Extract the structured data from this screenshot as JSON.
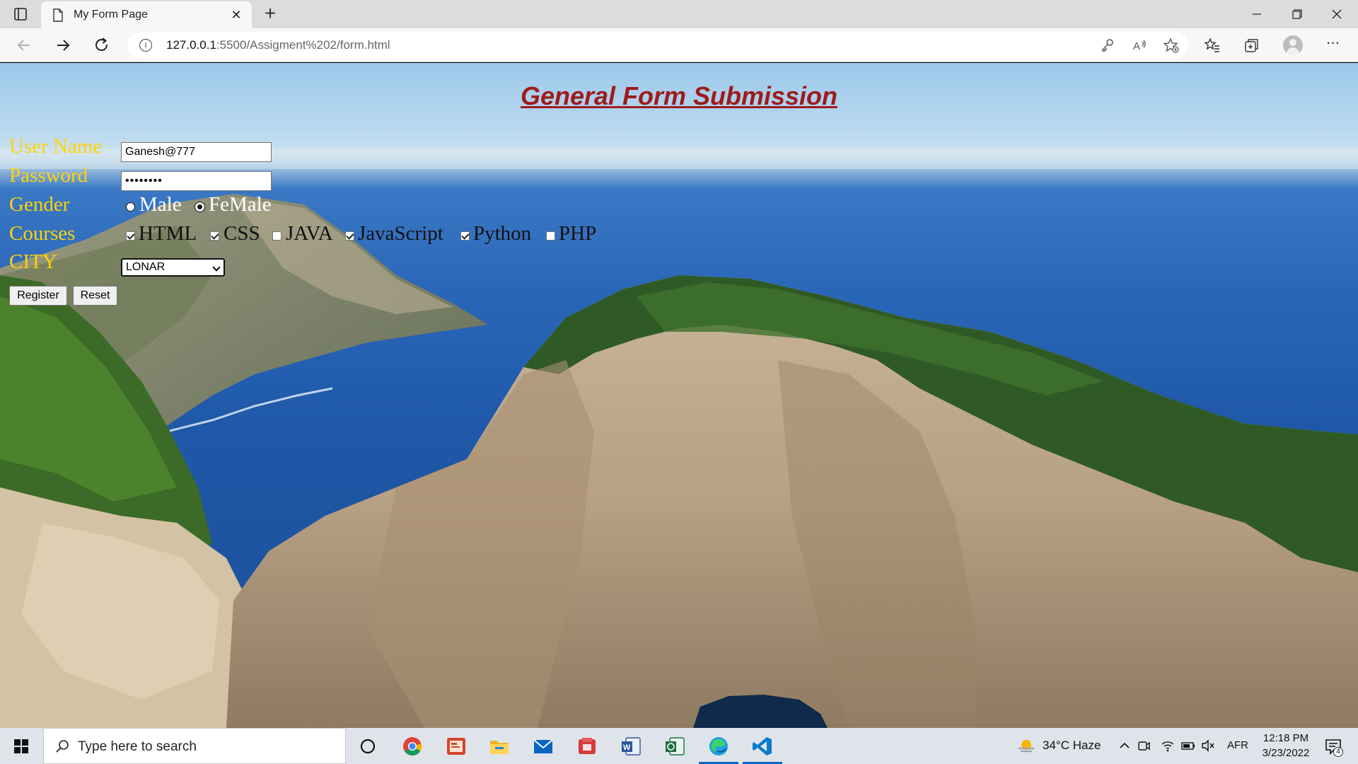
{
  "browser": {
    "tab_title": "My Form Page",
    "tab_close": "✕",
    "new_tab": "+",
    "url_host": "127.0.0.1",
    "url_path": ":5500/Assigment%202/form.html"
  },
  "page": {
    "title": "General Form Submission",
    "title_color": "#9e1b1b",
    "label_color": "#ffd400",
    "labels": {
      "user": "User Name",
      "password": "Password",
      "gender": "Gender",
      "courses": "Courses",
      "city": "CITY"
    },
    "user_value": "Ganesh@777",
    "password_value": "••••••••",
    "gender": {
      "options": [
        "Male",
        "FeMale"
      ],
      "selected": "FeMale"
    },
    "courses": [
      {
        "label": "HTML",
        "checked": true
      },
      {
        "label": "CSS",
        "checked": true
      },
      {
        "label": "JAVA",
        "checked": false
      },
      {
        "label": "JavaScript",
        "checked": true
      },
      {
        "label": "Python",
        "checked": true
      },
      {
        "label": "PHP",
        "checked": false
      }
    ],
    "city_selected": "LONAR",
    "buttons": {
      "register": "Register",
      "reset": "Reset"
    }
  },
  "taskbar": {
    "search_placeholder": "Type here to search",
    "weather": "34°C  Haze",
    "language": "AFR",
    "time": "12:18 PM",
    "date": "3/23/2022",
    "notification_count": "4",
    "apps": [
      "cortana-icon",
      "chrome-icon",
      "powerpoint-icon",
      "file-explorer-icon",
      "mail-icon",
      "app-red-icon",
      "word-icon",
      "excel-icon",
      "edge-icon",
      "vscode-icon"
    ]
  }
}
